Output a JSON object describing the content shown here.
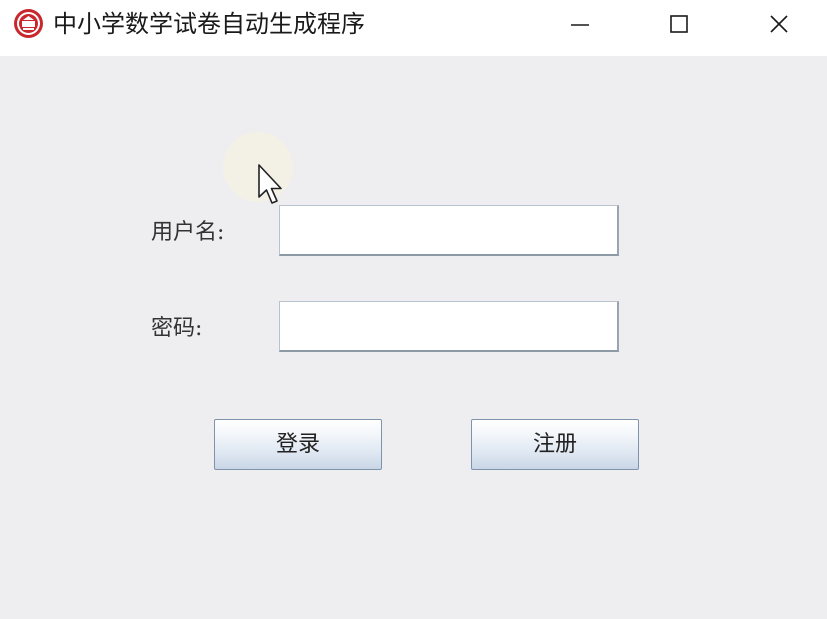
{
  "window": {
    "title": "中小学数学试卷自动生成程序",
    "app_icon": "school-emblem-icon",
    "controls": {
      "minimize_icon": "minimize-icon",
      "maximize_icon": "maximize-icon",
      "close_icon": "close-icon"
    }
  },
  "form": {
    "username_label": "用户名:",
    "username_value": "",
    "password_label": "密码:",
    "password_value": ""
  },
  "buttons": {
    "login_label": "登录",
    "register_label": "注册"
  },
  "colors": {
    "background": "#eeeef0",
    "titlebar": "#ffffff",
    "emblem_red": "#c8282d"
  }
}
